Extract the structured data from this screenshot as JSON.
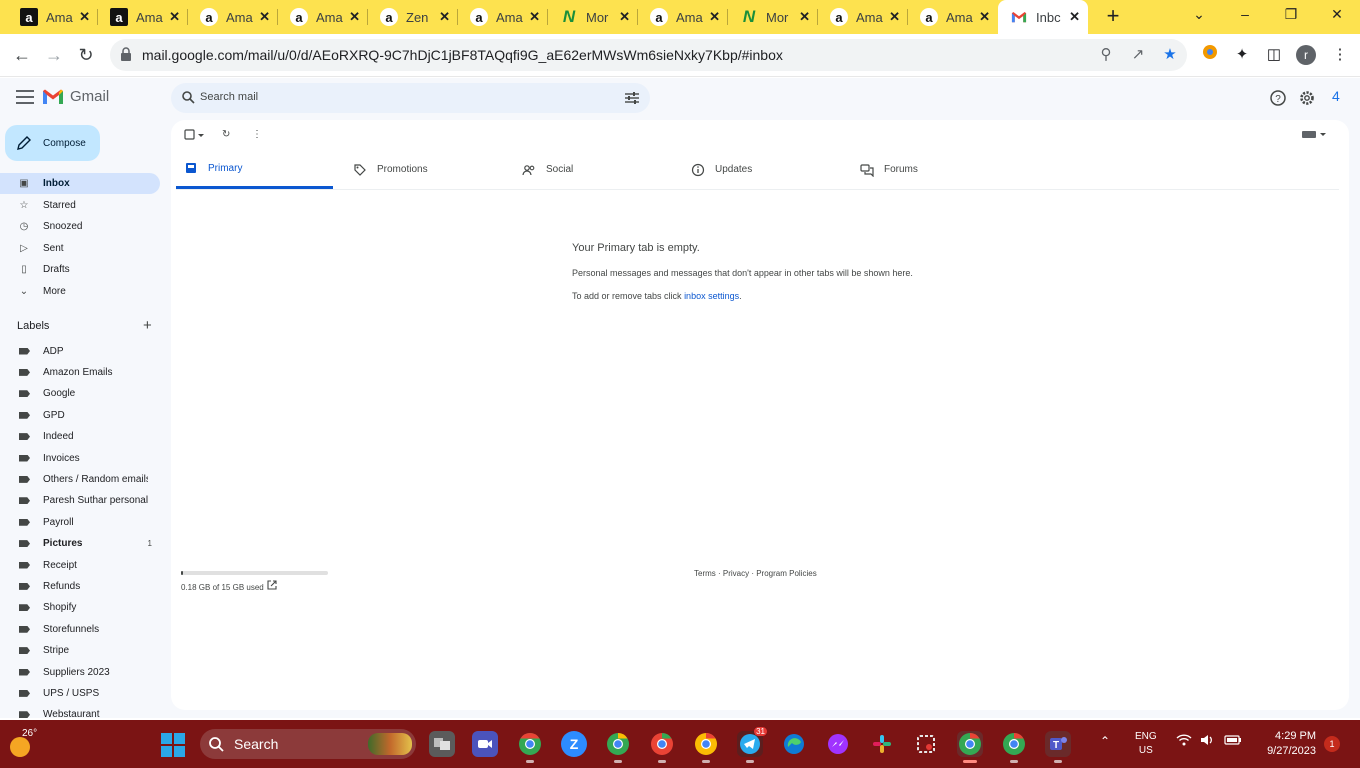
{
  "browser": {
    "tabs": [
      {
        "title": "Ama",
        "favicon": "amazon-icon"
      },
      {
        "title": "Ama",
        "favicon": "amazon-icon"
      },
      {
        "title": "Ama",
        "favicon": "amazon-smile-icon"
      },
      {
        "title": "Ama",
        "favicon": "amazon-smile-icon"
      },
      {
        "title": "Zen",
        "favicon": "zen-icon"
      },
      {
        "title": "Ama",
        "favicon": "amazon-smile-icon"
      },
      {
        "title": "Mor",
        "favicon": "monday-icon"
      },
      {
        "title": "Ama",
        "favicon": "amazon-smile-icon"
      },
      {
        "title": "Mor",
        "favicon": "monday-icon"
      },
      {
        "title": "Ama",
        "favicon": "amazon-smile-icon"
      },
      {
        "title": "Ama",
        "favicon": "amazon-smile-icon"
      },
      {
        "title": "Inbc",
        "favicon": "gmail-icon",
        "active": true
      }
    ],
    "url": "mail.google.com/mail/u/0/d/AEoRXRQ-9C7hDjC1jBF8TAQqfi9G_aE62erMWsWm6sieNxky7Kbp/#inbox",
    "profile_initial": "r",
    "tabstrip_color": "#fde24f"
  },
  "gmail": {
    "brand": "Gmail",
    "search_placeholder": "Search mail",
    "account_badge": "4",
    "compose_label": "Compose",
    "nav": [
      {
        "label": "Inbox",
        "icon": "inbox-icon",
        "selected": true
      },
      {
        "label": "Starred",
        "icon": "star-icon"
      },
      {
        "label": "Snoozed",
        "icon": "clock-icon"
      },
      {
        "label": "Sent",
        "icon": "send-icon"
      },
      {
        "label": "Drafts",
        "icon": "draft-icon"
      },
      {
        "label": "More",
        "icon": "chevron-down-icon"
      }
    ],
    "labels_heading": "Labels",
    "labels": [
      {
        "name": "ADP"
      },
      {
        "name": "Amazon Emails"
      },
      {
        "name": "Google"
      },
      {
        "name": "GPD"
      },
      {
        "name": "Indeed"
      },
      {
        "name": "Invoices"
      },
      {
        "name": "Others / Random emails"
      },
      {
        "name": "Paresh Suthar personal ..."
      },
      {
        "name": "Payroll"
      },
      {
        "name": "Pictures",
        "count": "1",
        "bold": true
      },
      {
        "name": "Receipt"
      },
      {
        "name": "Refunds"
      },
      {
        "name": "Shopify"
      },
      {
        "name": "Storefunnels"
      },
      {
        "name": "Stripe"
      },
      {
        "name": "Suppliers 2023"
      },
      {
        "name": "UPS / USPS"
      },
      {
        "name": "Webstaurant"
      }
    ],
    "inbox_tabs": [
      {
        "label": "Primary",
        "icon": "inbox-tab-icon",
        "active": true
      },
      {
        "label": "Promotions",
        "icon": "tag-icon"
      },
      {
        "label": "Social",
        "icon": "people-icon"
      },
      {
        "label": "Updates",
        "icon": "info-icon"
      },
      {
        "label": "Forums",
        "icon": "forum-icon"
      }
    ],
    "empty_state": {
      "title": "Your Primary tab is empty.",
      "description": "Personal messages and messages that don't appear in other tabs will be shown here.",
      "hint_prefix": "To add or remove tabs click ",
      "hint_link": "inbox settings",
      "hint_suffix": "."
    },
    "storage": {
      "text": "0.18 GB of 15 GB used",
      "used_fraction": 0.012
    },
    "footer": "Terms · Privacy · Program Policies"
  },
  "taskbar": {
    "temperature": "26°",
    "search_label": "Search",
    "telegram_badge": "31",
    "language": "ENG",
    "region": "US",
    "time": "4:29 PM",
    "date": "9/27/2023",
    "notifications": "1",
    "color": "#7b1414"
  }
}
